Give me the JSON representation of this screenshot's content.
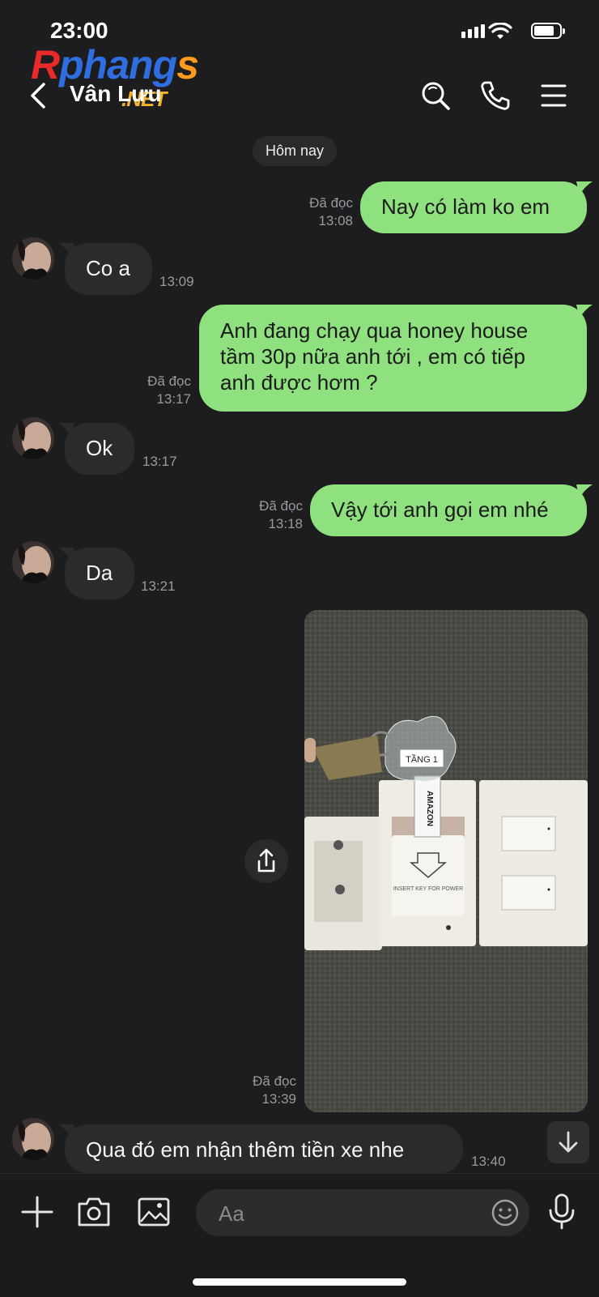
{
  "status_bar": {
    "time": "23:00"
  },
  "watermark": {
    "part1": "R",
    "part2": "phang",
    "part3": "s",
    "net": ".NET"
  },
  "header": {
    "contact_name": "Vân Lưu",
    "icons": [
      "back-icon",
      "search-icon",
      "phone-icon",
      "menu-icon"
    ]
  },
  "date_divider": "Hôm nay",
  "messages": [
    {
      "dir": "out",
      "text": "Nay có làm ko em",
      "status": "Đã đọc",
      "time": "13:08"
    },
    {
      "dir": "in",
      "text": "Co a",
      "time": "13:09"
    },
    {
      "dir": "out",
      "text": "Anh đang chạy qua honey house tầm 30p nữa anh tới , em có tiếp anh được hơm ?",
      "status": "Đã đọc",
      "time": "13:17"
    },
    {
      "dir": "in",
      "text": "Ok",
      "time": "13:17"
    },
    {
      "dir": "out",
      "text": "Vậy tới anh gọi em nhé",
      "status": "Đã đọc",
      "time": "13:18"
    },
    {
      "dir": "in",
      "text": "Da",
      "time": "13:21"
    },
    {
      "dir": "out",
      "type": "photo",
      "status": "Đã đọc",
      "time": "13:39",
      "photo_labels": {
        "tag": "TẦNG 1",
        "card": "AMAZON",
        "slot": "INSERT KEY FOR POWER"
      }
    },
    {
      "dir": "in",
      "text": "Qua đó em nhận thêm tiền xe nhe",
      "time": "13:40"
    }
  ],
  "composer": {
    "placeholder": "Aa",
    "icons": [
      "plus-icon",
      "camera-icon",
      "image-icon",
      "emoji-icon",
      "mic-icon"
    ]
  },
  "colors": {
    "background": "#1d1d1f",
    "bubble_out": "#8fe07e",
    "bubble_in": "#2b2b2d"
  }
}
